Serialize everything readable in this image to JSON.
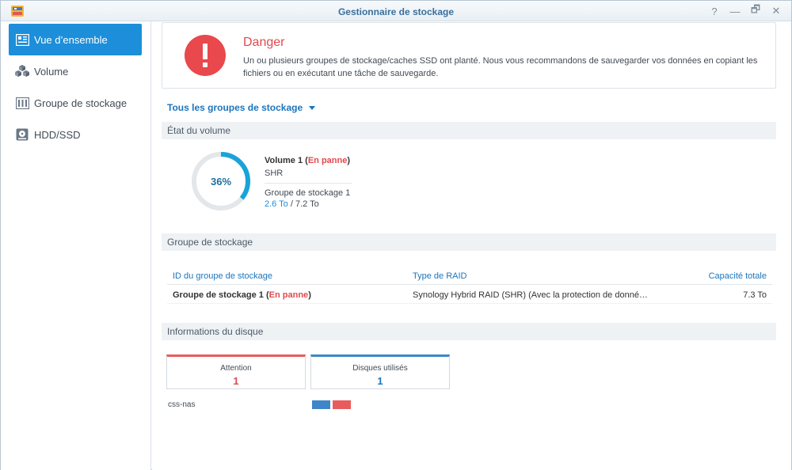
{
  "window": {
    "title": "Gestionnaire de stockage",
    "controls": [
      "?",
      "—",
      "🗗",
      "✕"
    ]
  },
  "sidebar": {
    "items": [
      {
        "label": "Vue d’ensemble",
        "icon": "overview-icon",
        "active": true
      },
      {
        "label": "Volume",
        "icon": "volume-icon",
        "active": false
      },
      {
        "label": "Groupe de stockage",
        "icon": "storage-pool-icon",
        "active": false
      },
      {
        "label": "HDD/SSD",
        "icon": "hdd-icon",
        "active": false
      }
    ]
  },
  "alert": {
    "title": "Danger",
    "message": "Un ou plusieurs groupes de stockage/caches SSD ont planté. Nous vous recommandons de sauvegarder vos données en copiant les fichiers ou en exécutant une tâche de sauvegarde.",
    "color": "#e1494d"
  },
  "filter": {
    "label": "Tous les groupes de stockage"
  },
  "volume_section": {
    "header": "État du volume",
    "usage_percent": 36,
    "usage_label": "36%",
    "name": "Volume 1",
    "status": "En panne",
    "type": "SHR",
    "pool": "Groupe de stockage 1",
    "used": "2.6 To",
    "total": "7.2 To"
  },
  "pool_section": {
    "header": "Groupe de stockage",
    "columns": [
      "ID du groupe de stockage",
      "Type de RAID",
      "Capacité totale"
    ],
    "rows": [
      {
        "name": "Groupe de stockage 1",
        "status": "En panne",
        "raid": "Synology Hybrid RAID (SHR) (Avec la protection de donné…",
        "capacity": "7.3 To"
      }
    ]
  },
  "disk_section": {
    "header": "Informations du disque",
    "attention_label": "Attention",
    "attention_value": "1",
    "used_label": "Disques utilisés",
    "used_value": "1",
    "host": "css-nas",
    "slots": [
      {
        "state": "normal",
        "color": "#3f86c8"
      },
      {
        "state": "failed",
        "color": "#e85c5d"
      }
    ]
  },
  "colors": {
    "accent": "#1d8ed9",
    "danger": "#e1494d",
    "link": "#1c75bc"
  }
}
